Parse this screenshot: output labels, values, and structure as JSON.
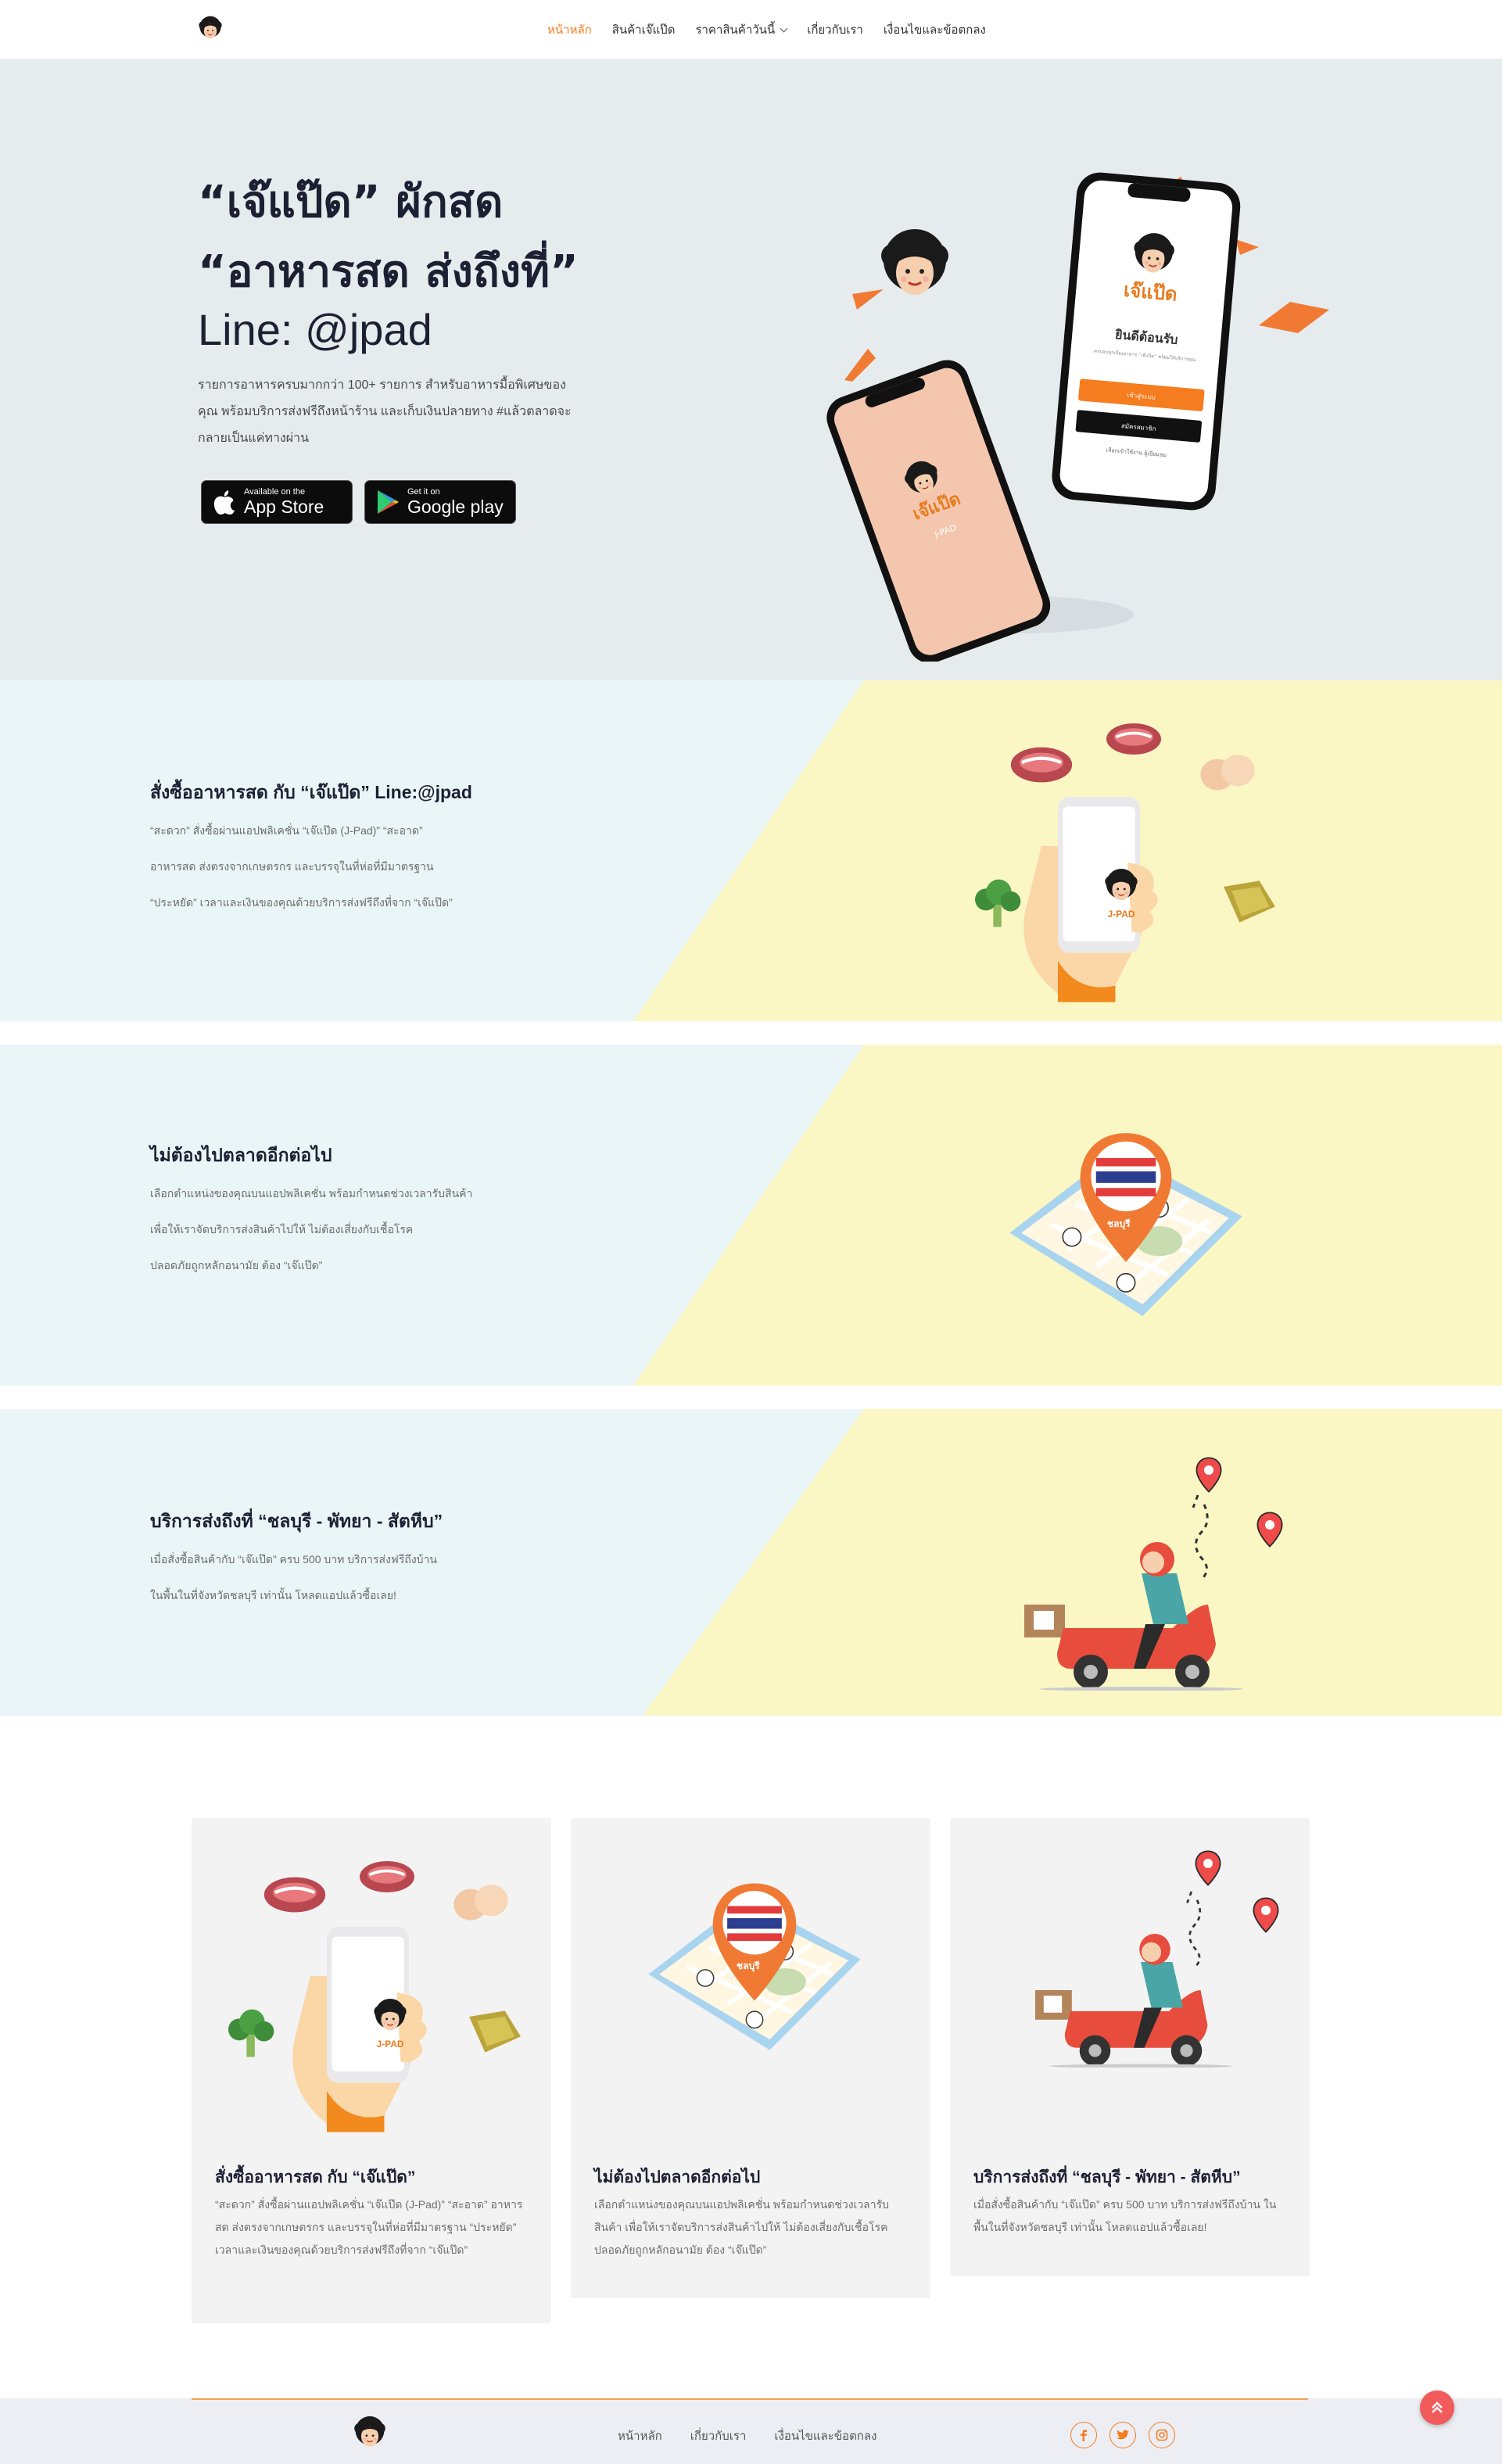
{
  "colors": {
    "accent": "#f57c1f",
    "heading": "#1c2033",
    "band_left": "#e9f5f6",
    "band_right": "#fbf7c4",
    "hero_bg": "#e6ebed"
  },
  "nav": {
    "items": [
      {
        "label": "หน้าหลัก",
        "active": true
      },
      {
        "label": "สินค้าเจ๊แป๊ด"
      },
      {
        "label": "ราคาสินค้าวันนี้"
      },
      {
        "label": "เกี่ยวกับเรา"
      },
      {
        "label": "เงื่อนไขและข้อตกลง"
      }
    ]
  },
  "hero": {
    "line1": "“เจ๊แป๊ด” ผักสด",
    "line2": "“อาหารสด ส่งถึงที่”",
    "line3": "Line: @jpad",
    "desc": "รายการอาหารครบมากกว่า 100+ รายการ สำหรับอาหารมื้อพิเศษของคุณ พร้อมบริการส่งฟรีถึงหน้าร้าน และเก็บเงินปลายทาง #แล้วตลาดจะกลายเป็นแค่ทางผ่าน",
    "appstore_small": "Available on the",
    "appstore_big": "App Store",
    "googleplay_small": "Get it on",
    "googleplay_big": "Google play",
    "phone_brand": "เจ๊แป๊ด",
    "phone_brand_sub": "J-PAD",
    "welcome": "ยินดีต้อนรับ",
    "welcome_sub": "ครบจบทุกเรื่องอาหาร “เจ๊แป๊ด” พร้อมให้บริการคุณ",
    "login": "เข้าสู่ระบบ",
    "register": "สมัครสมาชิก",
    "skip": "เลือกเข้าใช้งาน ผู้เยี่ยมชม"
  },
  "bands": [
    {
      "title": "สั่งซื้ออาหารสด กับ “เจ๊แป๊ด” Line:@jpad",
      "lines": [
        "“สะดวก” สั่งซื้อผ่านแอปพลิเคชั่น “เจ๊แป๊ด (J-Pad)” “สะอาด”",
        "อาหารสด ส่งตรงจากเกษตรกร และบรรจุในที่ห่อที่มีมาตรฐาน",
        "“ประหยัด” เวลาและเงินของคุณด้วยบริการส่งฟรีถึงที่จาก “เจ๊แป๊ด”"
      ]
    },
    {
      "title": "ไม่ต้องไปตลาดอีกต่อไป",
      "lines": [
        "เลือกตำแหน่งของคุณบนแอปพลิเคชั่น พร้อมกำหนดช่วงเวลารับสินค้า",
        "เพื่อให้เราจัดบริการส่งสินค้าไปให้ ไม่ต้องเสี่ยงกับเชื้อโรค",
        "ปลอดภัยถูกหลักอนามัย ต้อง “เจ๊แป๊ด”"
      ]
    },
    {
      "title": "บริการส่งถึงที่ “ชลบุรี - พัทยา - สัตหีบ”",
      "lines": [
        "เมื่อสั่งซื้อสินค้ากับ “เจ๊แป๊ด” ครบ 500 บาท บริการส่งฟรีถึงบ้าน",
        "ในพื้นในที่จังหวัดชลบุรี เท่านั้น โหลดแอปแล้วซื้อเลย!"
      ]
    }
  ],
  "map_label": "ชลบุรี",
  "phone_label": "J-PAD",
  "cards": [
    {
      "title": "สั่งซื้ออาหารสด กับ “เจ๊แป๊ด”",
      "text": "“สะดวก” สั่งซื้อผ่านแอปพลิเคชั่น “เจ๊แป๊ด (J-Pad)” “สะอาด” อาหารสด ส่งตรงจากเกษตรกร และบรรจุในที่ห่อที่มีมาตรฐาน “ประหยัด” เวลาและเงินของคุณด้วยบริการส่งฟรีถึงที่จาก “เจ๊แป๊ด”"
    },
    {
      "title": "ไม่ต้องไปตลาดอีกต่อไป",
      "text": "เลือกตำแหน่งของคุณบนแอปพลิเคชั่น พร้อมกำหนดช่วงเวลารับสินค้า เพื่อให้เราจัดบริการส่งสินค้าไปให้ ไม่ต้องเสี่ยงกับเชื้อโรค ปลอดภัยถูกหลักอนามัย ต้อง “เจ๊แป๊ด”"
    },
    {
      "title": "บริการส่งถึงที่ “ชลบุรี - พัทยา - สัตหีบ”",
      "text": "เมื่อสั่งซื้อสินค้ากับ “เจ๊แป๊ด” ครบ 500 บาท บริการส่งฟรีถึงบ้าน ในพื้นในที่จังหวัดชลบุรี เท่านั้น โหลดแอปแล้วซื้อเลย!"
    }
  ],
  "footer": {
    "links": [
      "หน้าหลัก",
      "เกี่ยวกับเรา",
      "เงื่อนไขและข้อตกลง"
    ],
    "social": [
      "facebook-icon",
      "twitter-icon",
      "instagram-icon"
    ]
  }
}
